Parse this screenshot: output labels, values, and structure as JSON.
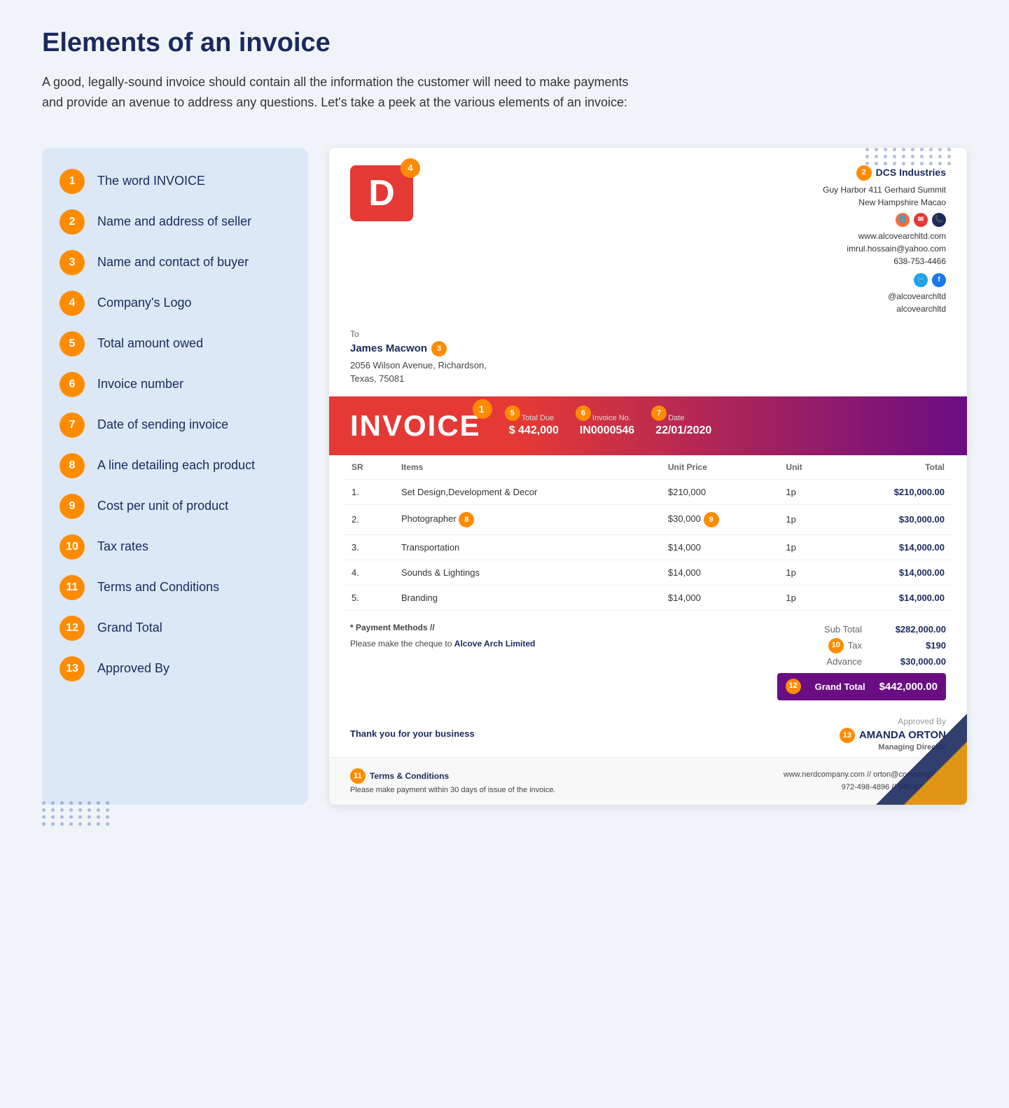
{
  "page": {
    "title": "Elements of an invoice",
    "description": "A good, legally-sound invoice should contain all the information the customer will need to make payments and provide an avenue to address any questions. Let's take a peek at the various elements of an invoice:"
  },
  "left_list": [
    {
      "number": "1",
      "text": "The word INVOICE"
    },
    {
      "number": "2",
      "text": "Name and address of seller"
    },
    {
      "number": "3",
      "text": "Name and contact of buyer"
    },
    {
      "number": "4",
      "text": "Company's Logo"
    },
    {
      "number": "5",
      "text": "Total amount owed"
    },
    {
      "number": "6",
      "text": "Invoice number"
    },
    {
      "number": "7",
      "text": "Date of sending invoice"
    },
    {
      "number": "8",
      "text": "A line detailing each product"
    },
    {
      "number": "9",
      "text": "Cost per unit of product"
    },
    {
      "number": "10",
      "text": "Tax rates"
    },
    {
      "number": "11",
      "text": "Terms and Conditions"
    },
    {
      "number": "12",
      "text": "Grand Total"
    },
    {
      "number": "13",
      "text": "Approved By"
    }
  ],
  "invoice": {
    "logo_letter": "D",
    "logo_badge": "4",
    "seller": {
      "badge": "2",
      "name": "DCS Industries",
      "address": "Guy Harbor 411 Gerhard Summit",
      "city": "New Hampshire Macao",
      "website": "www.alcovearchltd.com",
      "email": "imrul.hossain@yahoo.com",
      "phone": "638-753-4466",
      "twitter": "@alcovearchltd",
      "facebook": "alcovearchltd"
    },
    "buyer": {
      "badge": "3",
      "to_label": "To",
      "name": "James Macwon",
      "address": "2056  Wilson Avenue, Richardson,",
      "city": "Texas, 75081"
    },
    "banner": {
      "word": "INVOICE",
      "word_badge": "1",
      "total_due_label": "Total Due",
      "total_due_badge": "5",
      "total_due_value": "$ 442,000",
      "invoice_no_label": "Invoice No.",
      "invoice_no_badge": "6",
      "invoice_no_value": "IN0000546",
      "date_label": "Date",
      "date_badge": "7",
      "date_value": "22/01/2020"
    },
    "table": {
      "headers": [
        "SR",
        "Items",
        "Unit Price",
        "Unit",
        "Total"
      ],
      "rows": [
        {
          "sr": "1.",
          "item": "Set Design,Development & Decor",
          "unit_price": "$210,000",
          "unit": "1p",
          "total": "$210,000.00",
          "item_badge": null,
          "price_badge": null
        },
        {
          "sr": "2.",
          "item": "Photographer",
          "unit_price": "$30,000",
          "unit": "1p",
          "total": "$30,000.00",
          "item_badge": "8",
          "price_badge": "9"
        },
        {
          "sr": "3.",
          "item": "Transportation",
          "unit_price": "$14,000",
          "unit": "1p",
          "total": "$14,000.00",
          "item_badge": null,
          "price_badge": null
        },
        {
          "sr": "4.",
          "item": "Sounds & Lightings",
          "unit_price": "$14,000",
          "unit": "1p",
          "total": "$14,000.00",
          "item_badge": null,
          "price_badge": null
        },
        {
          "sr": "5.",
          "item": "Branding",
          "unit_price": "$14,000",
          "unit": "1p",
          "total": "$14,000.00",
          "item_badge": null,
          "price_badge": null
        }
      ]
    },
    "totals": {
      "subtotal_label": "Sub Total",
      "subtotal_value": "$282,000.00",
      "tax_label": "Tax",
      "tax_badge": "10",
      "tax_value": "$190",
      "advance_label": "Advance",
      "advance_value": "$30,000.00",
      "grand_total_label": "Grand Total",
      "grand_total_badge": "12",
      "grand_total_value": "$442,000.00"
    },
    "payment": {
      "title": "* Payment Methods //",
      "text": "Please make the cheque to",
      "company": "Alcove Arch Limited"
    },
    "thankyou": "Thank you for your business",
    "approved": {
      "badge": "13",
      "label": "Approved By",
      "name": "AMANDA ORTON",
      "title": "Managing Director"
    },
    "footer": {
      "terms_badge": "11",
      "terms_title": "Terms & Conditions",
      "terms_text": "Please make payment within 30 days of issue of the invoice.",
      "contact1": "www.nerdcompany.com  //  orton@company.com",
      "contact2": "972-498-4896  //  940-622-3895"
    }
  }
}
